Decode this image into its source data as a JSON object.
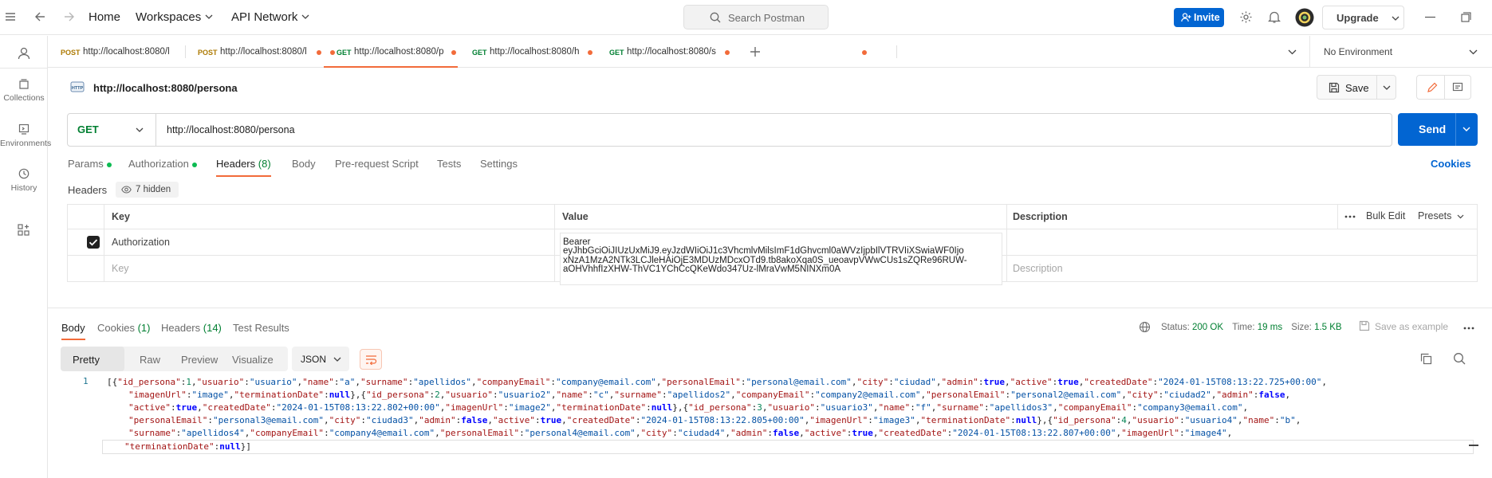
{
  "topbar": {
    "home": "Home",
    "workspaces": "Workspaces",
    "api_network": "API Network",
    "search_placeholder": "Search Postman",
    "invite": "Invite",
    "upgrade": "Upgrade"
  },
  "sidebar": {
    "items": [
      {
        "label": "Collections",
        "icon": "collections-icon"
      },
      {
        "label": "Environments",
        "icon": "environments-icon"
      },
      {
        "label": "History",
        "icon": "history-icon"
      }
    ]
  },
  "tabs": [
    {
      "method": "POST",
      "url": "http://localhost:8080/l",
      "color": "#ad7a03"
    },
    {
      "method": "POST",
      "url": "http://localhost:8080/l",
      "color": "#ad7a03"
    },
    {
      "method": "GET",
      "url": "http://localhost:8080/p",
      "color": "#007f31",
      "active": true
    },
    {
      "method": "GET",
      "url": "http://localhost:8080/h",
      "color": "#007f31"
    },
    {
      "method": "GET",
      "url": "http://localhost:8080/s",
      "color": "#007f31"
    }
  ],
  "environment": "No Environment",
  "request": {
    "title": "http://localhost:8080/persona",
    "save": "Save",
    "method": "GET",
    "url": "http://localhost:8080/persona",
    "send": "Send"
  },
  "request_tabs": {
    "params": "Params",
    "authorization": "Authorization",
    "headers": "Headers",
    "headers_count": "(8)",
    "body": "Body",
    "pre_request": "Pre-request Script",
    "tests": "Tests",
    "settings": "Settings",
    "cookies": "Cookies"
  },
  "headers_section": {
    "label": "Headers",
    "hidden": "7 hidden",
    "col_key": "Key",
    "col_value": "Value",
    "col_description": "Description",
    "bulk_edit": "Bulk Edit",
    "presets": "Presets",
    "row": {
      "key": "Authorization",
      "value_lines": [
        "Bearer",
        "eyJhbGciOiJIUzUxMiJ9.eyJzdWIiOiJ1c3VhcmlvMilsImF1dGhvcml0aWVzIjpbIlVTRVIiXSwiaWF0Ijo",
        "xNzA1MzA2NTk3LCJleHAiOjE3MDUzMDcxOTd9.tb8akoXqa0S_ueoavpVWwCUs1sZQRe96RUW-",
        "aOHVhhfIzXHW-ThVC1YChCcQKeWdo347Uz-lMraVwM5NINXm0A"
      ]
    },
    "new_key_placeholder": "Key",
    "new_description_placeholder": "Description"
  },
  "response": {
    "tabs": {
      "body": "Body",
      "cookies": "Cookies",
      "cookies_count": "(1)",
      "headers": "Headers",
      "headers_count": "(14)",
      "test_results": "Test Results"
    },
    "status_label": "Status:",
    "status": "200 OK",
    "time_label": "Time:",
    "time": "19 ms",
    "size_label": "Size:",
    "size": "1.5 KB",
    "save_example": "Save as example",
    "formats": [
      "Pretty",
      "Raw",
      "Preview",
      "Visualize"
    ],
    "format_type": "JSON",
    "line_number": "1"
  },
  "colors": {
    "accent": "#0265d2",
    "active_tab": "#f26b3a",
    "status_ok": "#007f31"
  }
}
